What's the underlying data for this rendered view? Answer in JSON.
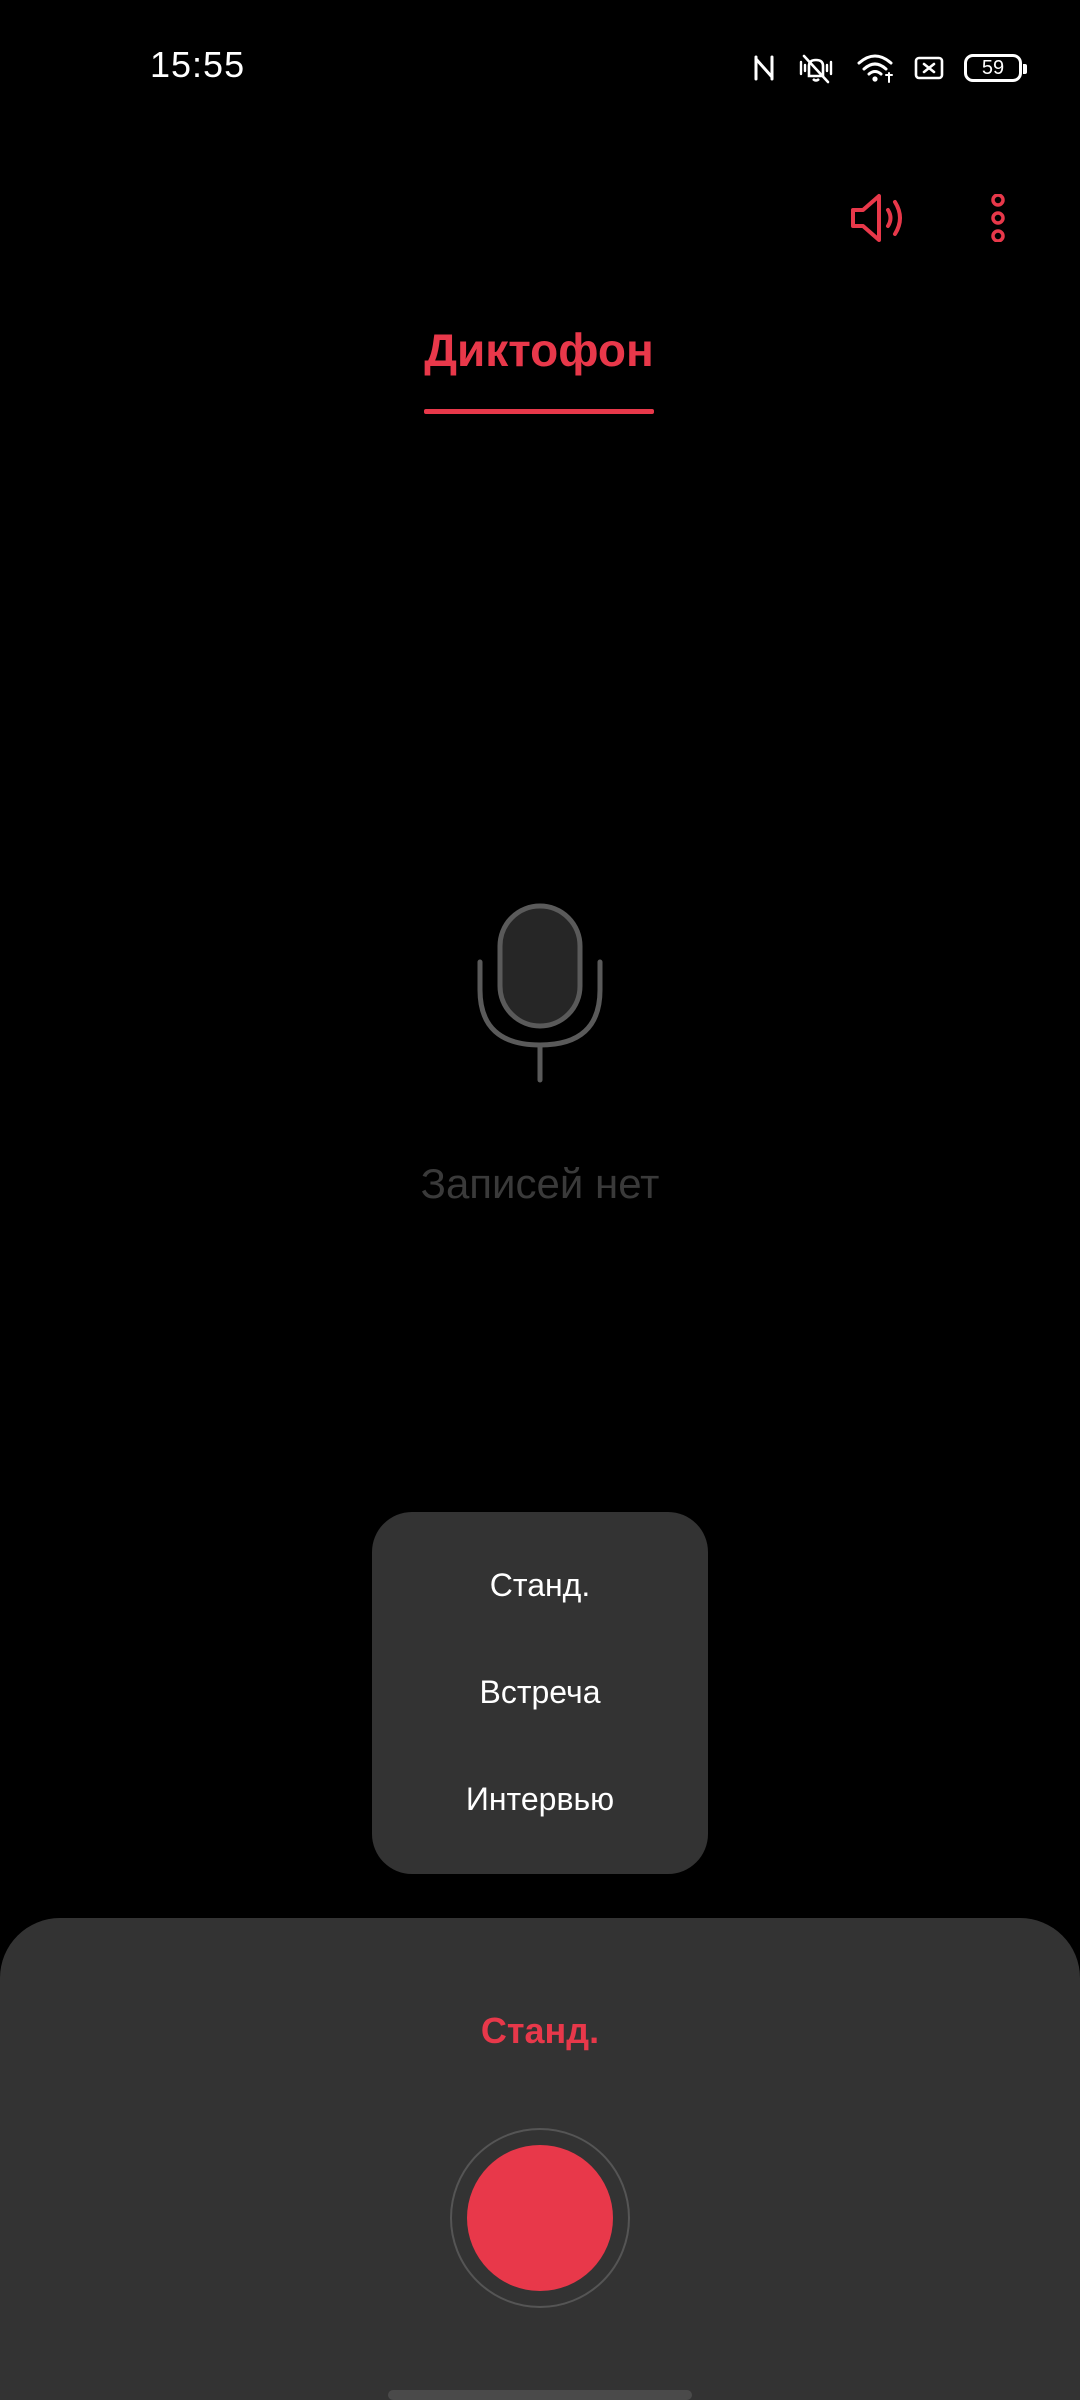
{
  "status_bar": {
    "time": "15:55",
    "battery_level": "59",
    "icons": [
      "nfc-icon",
      "vibrate-mute-icon",
      "wifi-icon",
      "battery-saver-icon",
      "battery-icon"
    ]
  },
  "toolbar": {
    "speaker_icon": "speaker-icon",
    "more_icon": "more-vertical-icon"
  },
  "header": {
    "title": "Диктофон"
  },
  "empty_state": {
    "icon": "microphone-icon",
    "message": "Записей нет"
  },
  "mode_menu": {
    "items": [
      {
        "label": "Станд."
      },
      {
        "label": "Встреча"
      },
      {
        "label": "Интервью"
      }
    ]
  },
  "bottom_panel": {
    "current_mode": "Станд.",
    "record_icon": "record-button-icon"
  },
  "colors": {
    "accent": "#e8384a",
    "background": "#000000",
    "panel": "#333333",
    "muted_text": "#3a3a3a"
  }
}
